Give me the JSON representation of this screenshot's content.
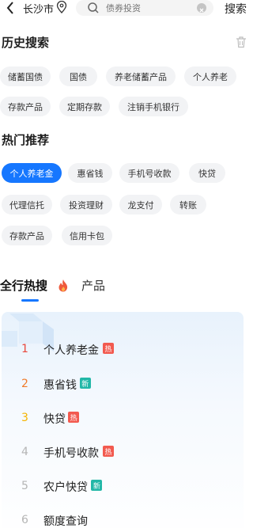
{
  "topbar": {
    "city": "长沙市",
    "search_placeholder": "债券投资",
    "search_button": "搜索"
  },
  "history": {
    "title": "历史搜索",
    "chips": [
      "储蓄国债",
      "国债",
      "养老储蓄产品",
      "个人养老",
      "存款产品",
      "定期存款",
      "注销手机银行"
    ]
  },
  "hot_recommend": {
    "title": "热门推荐",
    "chips": [
      "个人养老金",
      "惠省钱",
      "手机号收款",
      "快贷",
      "代理信托",
      "投资理财",
      "龙支付",
      "转账",
      "存款产品",
      "信用卡包"
    ],
    "active_index": 0
  },
  "tabs": {
    "active": "全行热搜",
    "second": "产品"
  },
  "hot_list": [
    {
      "rank": "1",
      "text": "个人养老金",
      "badge": "热",
      "rank_color": "#e8473c",
      "badge_color": "#f25a4f"
    },
    {
      "rank": "2",
      "text": "惠省钱",
      "badge": "新",
      "rank_color": "#f07b2a",
      "badge_color": "#22b7a7"
    },
    {
      "rank": "3",
      "text": "快贷",
      "badge": "热",
      "rank_color": "#f5b400",
      "badge_color": "#f25a4f"
    },
    {
      "rank": "4",
      "text": "手机号收款",
      "badge": "热",
      "rank_color": "#b5b5b5",
      "badge_color": "#f25a4f"
    },
    {
      "rank": "5",
      "text": "农户快贷",
      "badge": "新",
      "rank_color": "#b5b5b5",
      "badge_color": "#22b7a7"
    },
    {
      "rank": "6",
      "text": "额度查询",
      "badge": "",
      "rank_color": "#b5b5b5",
      "badge_color": ""
    }
  ]
}
